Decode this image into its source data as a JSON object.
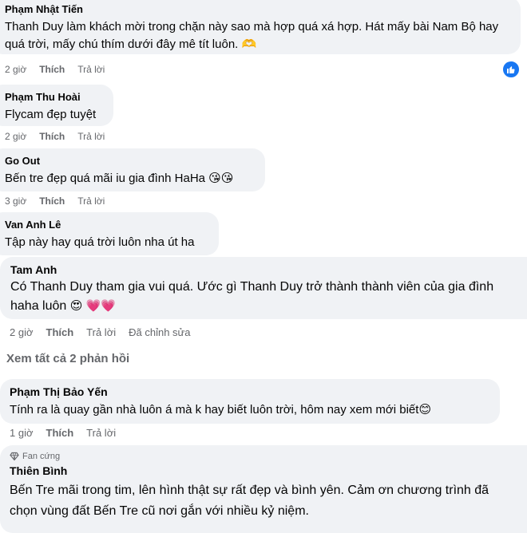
{
  "comments": [
    {
      "author": "Phạm Nhật Tiến",
      "text": "Thanh Duy làm khách mời trong chặn này sao mà hợp quá xá hợp. Hát mấy bài Nam Bộ hay quá trời, mấy chú thím dưới đây mê tít luôn.",
      "emoji": "🫶",
      "time": "2 giờ",
      "like": "Thích",
      "reply": "Trả lời"
    },
    {
      "author": "Phạm Thu Hoài",
      "text": "Flycam đẹp tuyệt",
      "time": "2 giờ",
      "like": "Thích",
      "reply": "Trả lời"
    },
    {
      "author": "Go Out",
      "text": "Bến tre đẹp quá mãi iu gia đình HaHa",
      "emoji": "😘😘",
      "time": "3 giờ",
      "like": "Thích",
      "reply": "Trả lời"
    },
    {
      "author": "Van Anh Lê",
      "text": "Tập này hay quá trời luôn nha út ha"
    },
    {
      "author": "Tam Anh",
      "text_line1": "Có Thanh Duy tham gia vui quá. Ước gì Thanh Duy trở thành thành viên của gia đình",
      "text_line2": "haha luôn",
      "emoji": "😍 💗💗",
      "time": "2 giờ",
      "like": "Thích",
      "reply": "Trả lời",
      "edited": "Đã chỉnh sửa"
    },
    {
      "author": "Phạm Thị Bảo Yến",
      "text": "Tính ra là quay gần nhà luôn á mà k hay biết luôn trời, hôm nay xem mới biết",
      "emoji": "😊",
      "time": "1 giờ",
      "like": "Thích",
      "reply": "Trả lời"
    },
    {
      "badge": "Fan cứng",
      "author": "Thiên Bình",
      "text_line1": "Bến Tre mãi trong tim, lên hình thật sự rất đẹp và bình yên. Cảm ơn chương trình đã",
      "text_line2": "chọn vùng đất Bến Tre cũ nơi gắn với nhiều kỷ niệm."
    }
  ],
  "see_more": "Xem tất cả 2 phản hồi",
  "colors": {
    "bubble": "#f0f2f5",
    "secondary": "#65676b",
    "like_blue": "#1877f2"
  },
  "icons": {
    "reaction": "like-thumb-icon",
    "fan_badge": "diamond-icon"
  }
}
